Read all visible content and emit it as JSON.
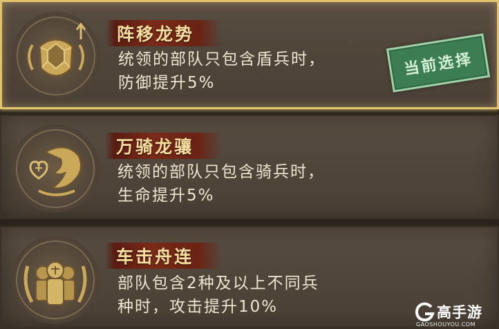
{
  "formations": [
    {
      "title": "阵移龙势",
      "desc_lines": [
        "统领的部队只包含盾兵时，",
        "防御提升5%"
      ],
      "selected": true,
      "icon": "shield-tortoise-icon"
    },
    {
      "title": "万骑龙骧",
      "desc_lines": [
        "统领的部队只包含骑兵时，",
        "生命提升5%"
      ],
      "selected": false,
      "icon": "dragon-heart-icon"
    },
    {
      "title": "车击舟连",
      "desc_lines": [
        "部队包含2种及以上不同兵",
        "种时，攻击提升10%"
      ],
      "selected": false,
      "icon": "soldiers-icon"
    }
  ],
  "current_selection_label": "当前选择",
  "watermark": {
    "name": "高手游",
    "url": "GAOSHOUYOU.COM"
  },
  "colors": {
    "gold": "#f4df9e",
    "stamp_green": "#3d7d54",
    "title_red": "#7a2a18"
  }
}
